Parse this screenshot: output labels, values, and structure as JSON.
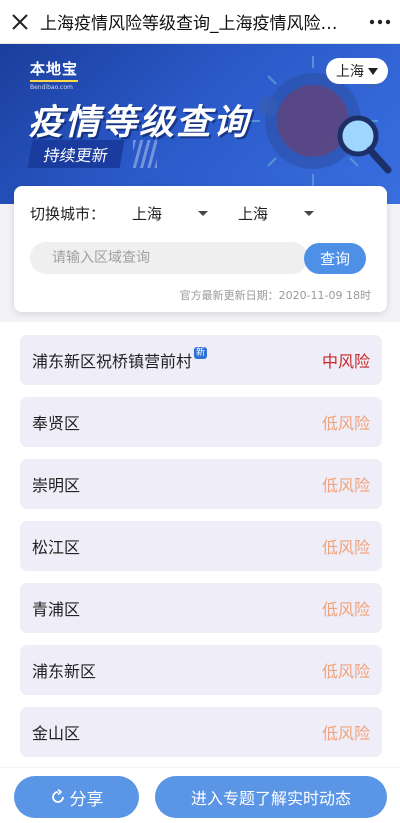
{
  "header": {
    "title": "上海疫情风险等级查询_上海疫情风险等级查询入口",
    "close_icon": "close-icon",
    "more_icon": "more-dots-icon"
  },
  "banner": {
    "logo_text": "本地宝",
    "logo_sub": "Bendibao.com",
    "headline": "疫情等级查询",
    "tagline": "持续更新",
    "city_button": "上海"
  },
  "search": {
    "switch_label": "切换城市：",
    "province": "上海",
    "city": "上海",
    "placeholder": "请输入区域查询",
    "query_button": "查询",
    "update_text": "官方最新更新日期：2020-11-09 18时"
  },
  "areas": [
    {
      "name": "浦东新区祝桥镇营前村",
      "risk": "中风险",
      "is_new": true,
      "new_label": "新",
      "color": "#c62828"
    },
    {
      "name": "奉贤区",
      "risk": "低风险",
      "is_new": false,
      "color": "#f0a27a"
    },
    {
      "name": "崇明区",
      "risk": "低风险",
      "is_new": false,
      "color": "#f0a27a"
    },
    {
      "name": "松江区",
      "risk": "低风险",
      "is_new": false,
      "color": "#f0a27a"
    },
    {
      "name": "青浦区",
      "risk": "低风险",
      "is_new": false,
      "color": "#f0a27a"
    },
    {
      "name": "浦东新区",
      "risk": "低风险",
      "is_new": false,
      "color": "#f0a27a"
    },
    {
      "name": "金山区",
      "risk": "低风险",
      "is_new": false,
      "color": "#f0a27a"
    }
  ],
  "footer": {
    "share_button": "分享",
    "enter_button": "进入专题了解实时动态"
  }
}
